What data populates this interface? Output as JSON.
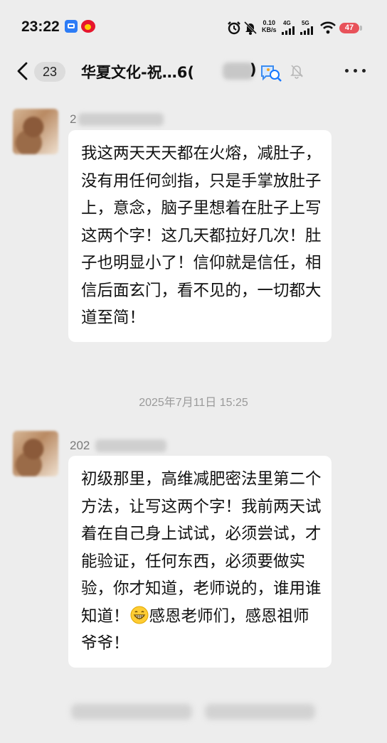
{
  "status_bar": {
    "time": "23:22",
    "net_speed_value": "0.10",
    "net_speed_unit": "KB/s",
    "signal_1_label": "4G",
    "signal_2_label": "5G",
    "battery": "47",
    "icons": [
      "browser-app-icon",
      "weibo-app-icon",
      "alarm-icon",
      "mute-bell-icon",
      "signal-icon",
      "signal-icon",
      "wifi-icon",
      "battery-icon"
    ]
  },
  "header": {
    "unread_count": "23",
    "title": "华夏文化-祝…6(",
    "title_suffix": ")",
    "icons": [
      "back-arrow-icon",
      "group-chat-icon",
      "mute-icon",
      "more-icon"
    ]
  },
  "messages": [
    {
      "sender_prefix": "2",
      "text": "我这两天天天都在火熔，减肚子，没有用任何剑指，只是手掌放肚子上，意念，脑子里想着在肚子上写这两个字！这几天都拉好几次！肚子也明显小了！信仰就是信任，相信后面玄门，看不见的，一切都大道至简！"
    },
    {
      "sender_prefix": "202",
      "text_before_emoji": "初级那里，高维减肥密法里第二个方法，让写这两个字！我前两天试着在自己身上试试，必须尝试，才能验证，任何东西，必须要做实验，你才知道，老师说的，谁用谁知道！",
      "emoji": "grinning-face-icon",
      "text_after_emoji": "感恩老师们，感恩祖师爷爷！"
    }
  ],
  "timestamp": "2025年7月11日 15:25"
}
